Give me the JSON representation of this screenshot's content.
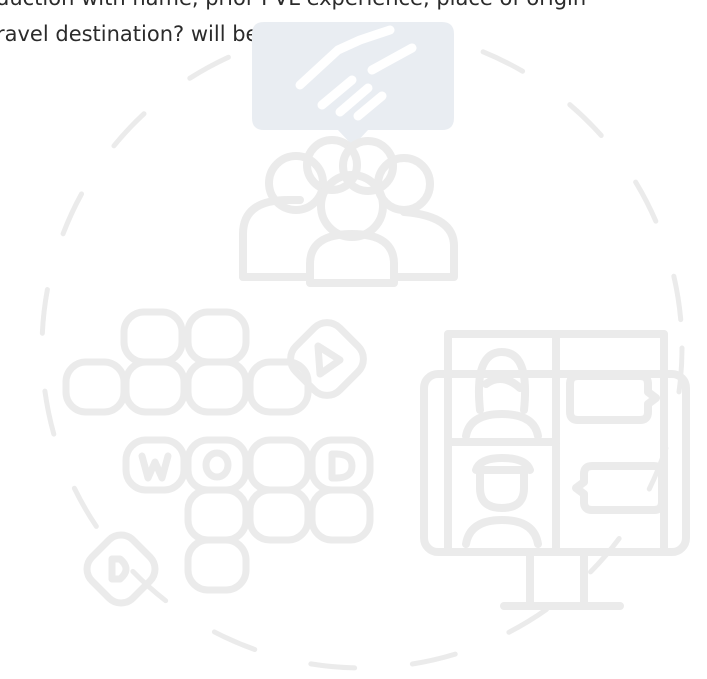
{
  "intro": {
    "line1": "duction with name, prior PVL experience, place of origin",
    "line2": "ravel destination? will be enough."
  },
  "illustration": {
    "stroke_color": "#ebebeb",
    "bubble_fill_color": "#e9edf2",
    "bubble_icon_color": "#ffffff",
    "icons": [
      "handshake-icon",
      "group-icon",
      "word-puzzle-icon",
      "video-call-icon",
      "dashed-circle"
    ],
    "word_tiles": [
      "W",
      "O",
      "D"
    ]
  }
}
